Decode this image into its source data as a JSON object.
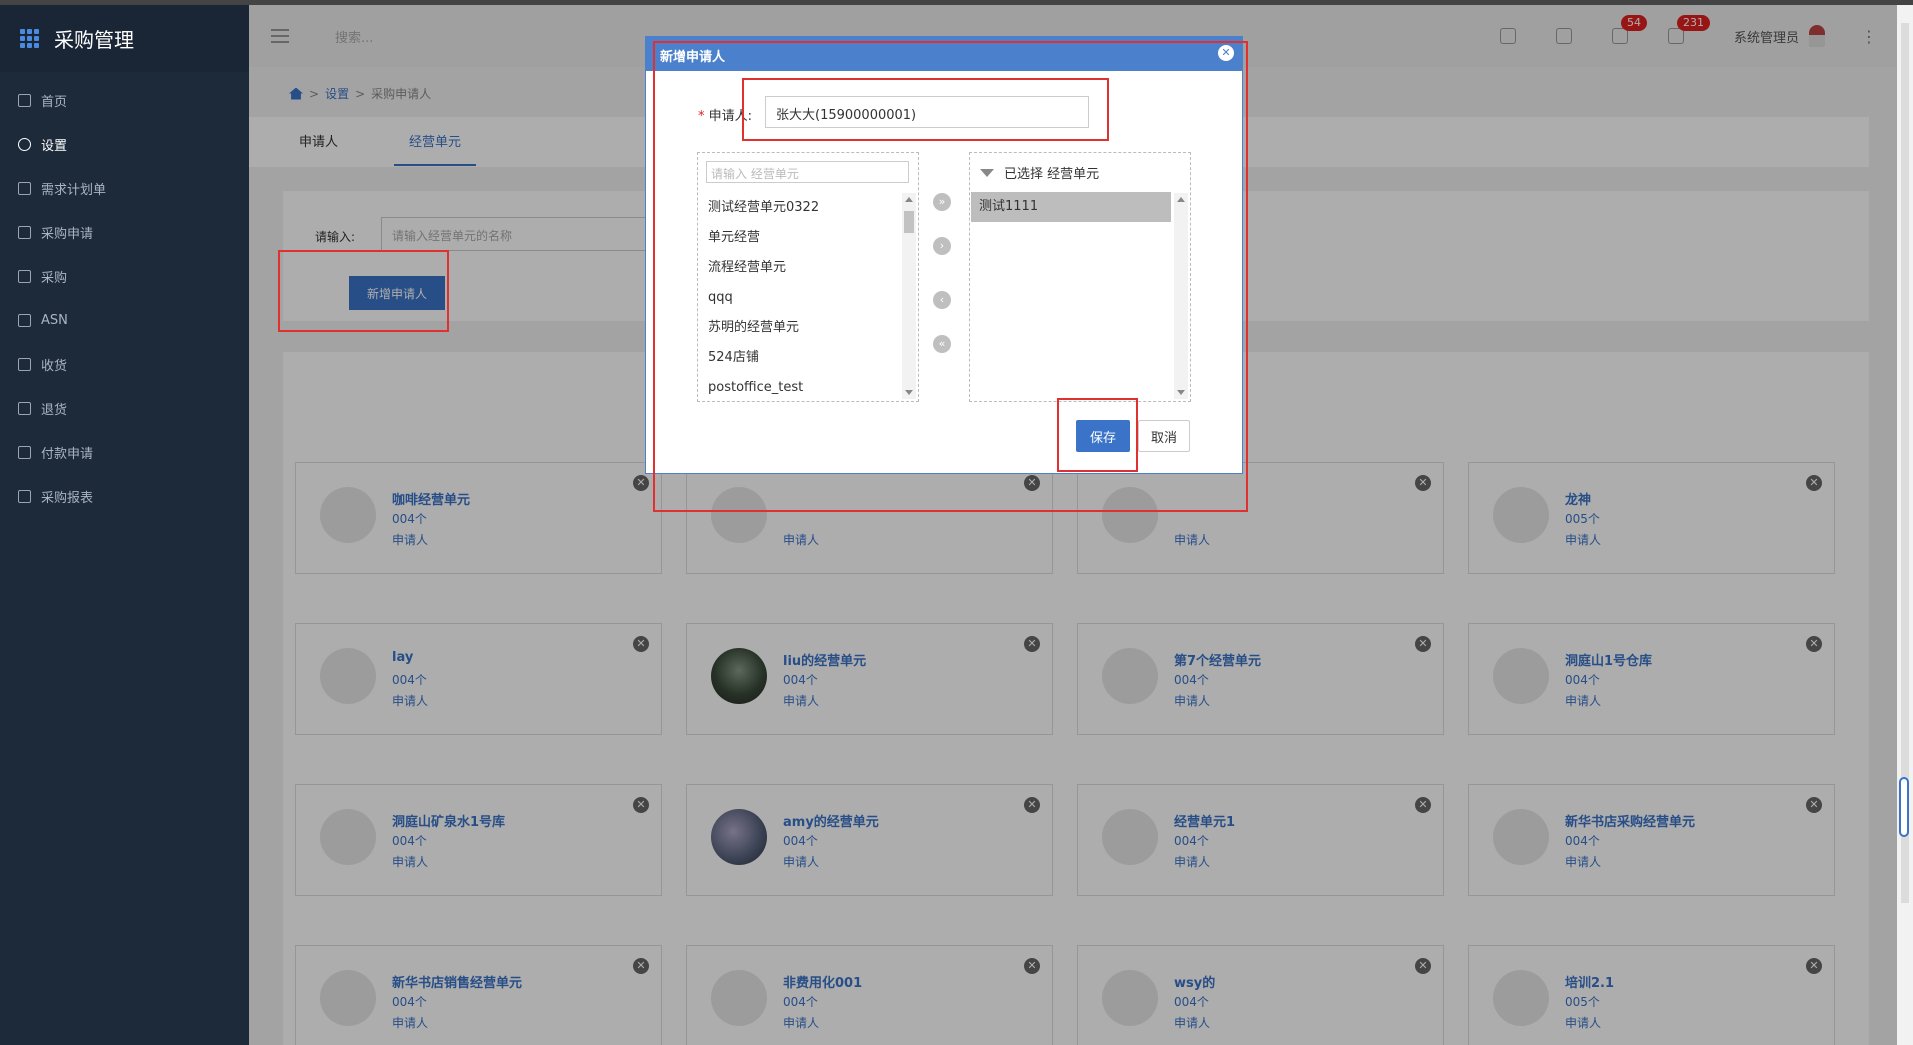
{
  "app": {
    "title": "采购管理"
  },
  "sidebar": {
    "items": [
      {
        "label": "首页"
      },
      {
        "label": "设置"
      },
      {
        "label": "需求计划单"
      },
      {
        "label": "采购申请"
      },
      {
        "label": "采购"
      },
      {
        "label": "ASN"
      },
      {
        "label": "收货"
      },
      {
        "label": "退货"
      },
      {
        "label": "付款申请"
      },
      {
        "label": "采购报表"
      }
    ]
  },
  "header": {
    "search_placeholder": "搜索...",
    "badge1": "54",
    "badge2": "231",
    "user": "系统管理员"
  },
  "breadcrumb": {
    "sep1": ">",
    "item1": "设置",
    "sep2": ">",
    "item2": "采购申请人"
  },
  "tabs": [
    {
      "label": "申请人"
    },
    {
      "label": "经营单元"
    }
  ],
  "filter": {
    "label": "请输入:",
    "placeholder": "请输入经营单元的名称",
    "add_button": "新增申请人"
  },
  "cards": [
    {
      "name": "咖啡经营单元",
      "count": "004个",
      "sub": "申请人"
    },
    {
      "name": "",
      "count": "",
      "sub": "申请人"
    },
    {
      "name": "",
      "count": "",
      "sub": "申请人"
    },
    {
      "name": "龙神",
      "count": "005个",
      "sub": "申请人"
    },
    {
      "name": "lay",
      "count": "004个",
      "sub": "申请人"
    },
    {
      "name": "liu的经营单元",
      "count": "004个",
      "sub": "申请人"
    },
    {
      "name": "第7个经营单元",
      "count": "004个",
      "sub": "申请人"
    },
    {
      "name": "洞庭山1号仓库",
      "count": "004个",
      "sub": "申请人"
    },
    {
      "name": "洞庭山矿泉水1号库",
      "count": "004个",
      "sub": "申请人"
    },
    {
      "name": "amy的经营单元",
      "count": "004个",
      "sub": "申请人"
    },
    {
      "name": "经营单元1",
      "count": "004个",
      "sub": "申请人"
    },
    {
      "name": "新华书店采购经营单元",
      "count": "004个",
      "sub": "申请人"
    },
    {
      "name": "新华书店销售经营单元",
      "count": "004个",
      "sub": "申请人"
    },
    {
      "name": "非费用化001",
      "count": "004个",
      "sub": "申请人"
    },
    {
      "name": "wsy的",
      "count": "004个",
      "sub": "申请人"
    },
    {
      "name": "培训2.1",
      "count": "005个",
      "sub": "申请人"
    }
  ],
  "dialog": {
    "title": "新增申请人",
    "applicant_star": "*",
    "applicant_label": "申请人:",
    "applicant_value": "张大大(15900000001)",
    "left_search_placeholder": "请输入 经营单元",
    "left_items": [
      "测试经营单元0322",
      "单元经营",
      "流程经营单元",
      "qqq",
      "苏明的经营单元",
      "524店铺",
      "postoffice_test"
    ],
    "right_header": "已选择 经营单元",
    "right_items": [
      "测试1111"
    ],
    "save": "保存",
    "cancel": "取消"
  },
  "colors": {
    "accent": "#3a73c8",
    "sidebar": "#1d2a3a",
    "highlight": "#e03030"
  }
}
